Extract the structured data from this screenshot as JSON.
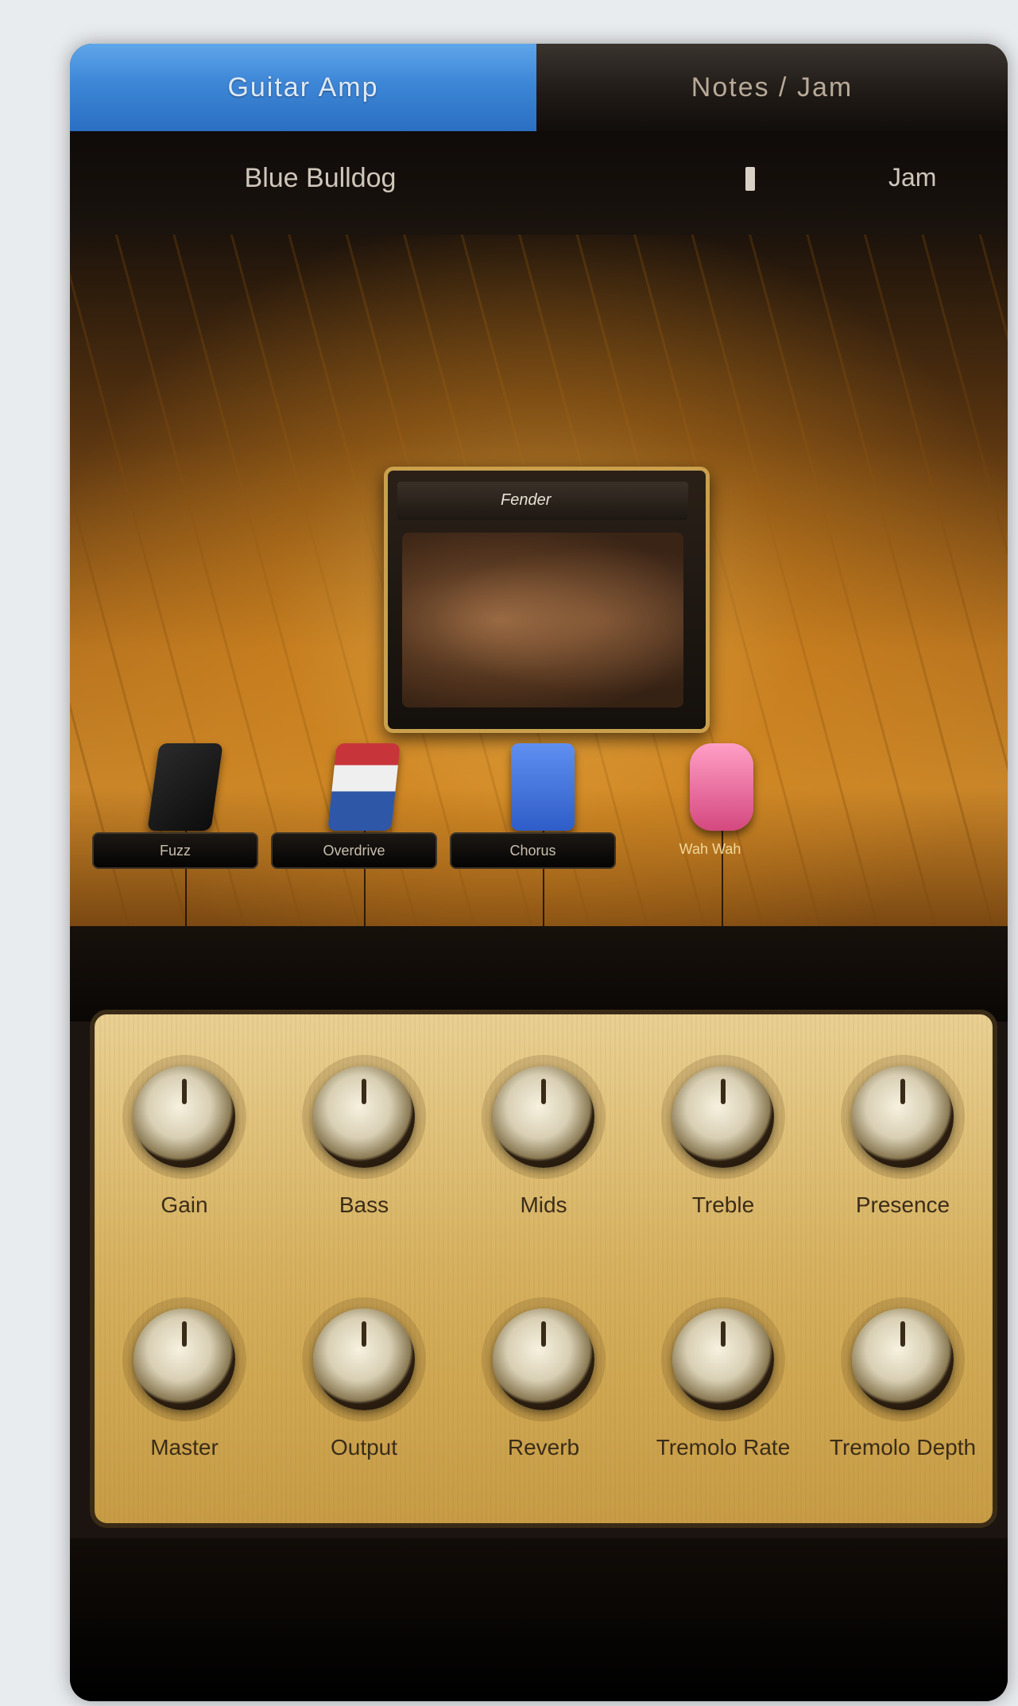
{
  "tabs": {
    "active": "Guitar Amp",
    "inactive": "Notes / Jam"
  },
  "header": {
    "preset_name": "Blue Bulldog",
    "settings_label": "Jam"
  },
  "amp": {
    "logo": "Fender"
  },
  "pedals": [
    {
      "label": "Fuzz",
      "icon": "fuzz-pedal-icon"
    },
    {
      "label": "Overdrive",
      "icon": "overdrive-pedal-icon"
    },
    {
      "label": "Chorus",
      "icon": "chorus-pedal-icon"
    },
    {
      "label": "Wah Wah",
      "icon": "wah-pedal-icon"
    }
  ],
  "knobs_row1": [
    "Gain",
    "Bass",
    "Mids",
    "Treble",
    "Presence"
  ],
  "knobs_row2": [
    "Master",
    "Output",
    "Reverb",
    "Tremolo Rate",
    "Tremolo Depth"
  ],
  "colors": {
    "tab_active": "#3d86d6",
    "panel": "#d6b15f",
    "stage": "#b8741f"
  }
}
